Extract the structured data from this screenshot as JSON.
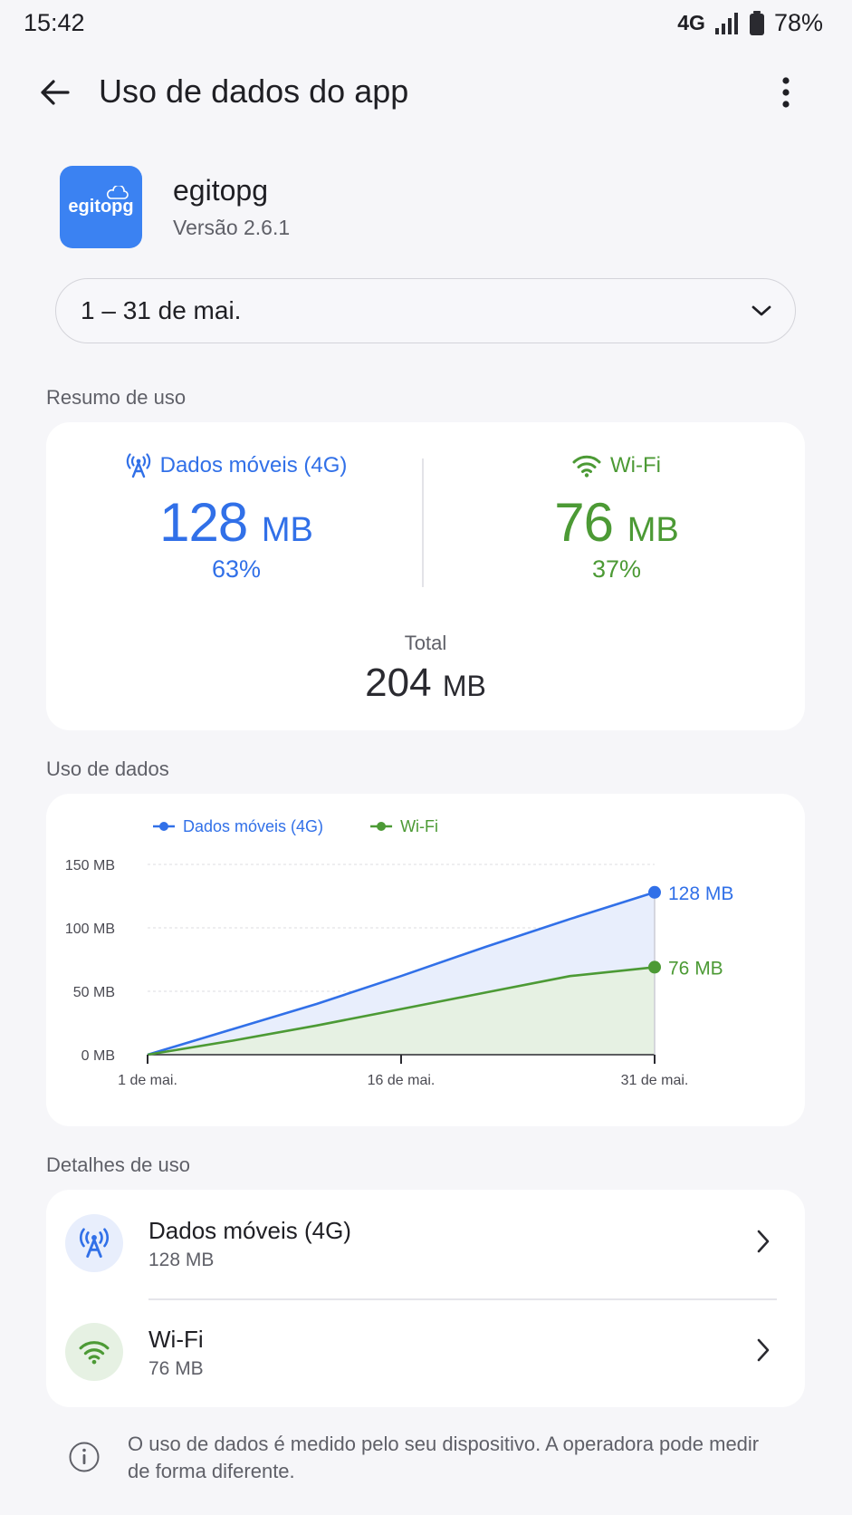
{
  "status_bar": {
    "time": "15:42",
    "network": "4G",
    "battery": "78%"
  },
  "app_bar": {
    "title": "Uso de dados do app",
    "back_icon": "arrow-left-icon",
    "more_icon": "more-vert-icon"
  },
  "app": {
    "icon_text": "egitopg",
    "name": "egitopg",
    "version": "Versão 2.6.1"
  },
  "date_range": {
    "value": "1 – 31 de mai."
  },
  "summary": {
    "label": "Resumo de uso",
    "mobile": {
      "label": "Dados móveis (4G)",
      "value": "128",
      "unit": "MB",
      "percent": "63%",
      "color": "#3170e8"
    },
    "wifi": {
      "label": "Wi-Fi",
      "value": "76",
      "unit": "MB",
      "percent": "37%",
      "color": "#4c9a35"
    },
    "total_label": "Total",
    "total_value": "204",
    "total_unit": "MB"
  },
  "usage_section": {
    "label": "Uso de dados"
  },
  "chart_data": {
    "type": "area",
    "title": "",
    "xlabel": "",
    "ylabel": "",
    "x_ticks": [
      "1 de mai.",
      "16 de mai.",
      "31 de mai."
    ],
    "x_domain": [
      1,
      31
    ],
    "ylim": [
      0,
      150
    ],
    "y_ticks": [
      "0 MB",
      "50 MB",
      "100 MB",
      "150 MB"
    ],
    "grid": true,
    "legend_placement": "top-left",
    "series": [
      {
        "name": "Dados móveis (4G)",
        "color": "#3170e8",
        "fill": "#e8eefc",
        "points": [
          [
            1,
            0
          ],
          [
            6,
            20
          ],
          [
            11,
            40
          ],
          [
            16,
            62
          ],
          [
            21,
            85
          ],
          [
            26,
            107
          ],
          [
            31,
            128
          ]
        ],
        "end_label": "128 MB"
      },
      {
        "name": "Wi-Fi",
        "color": "#4c9a35",
        "fill": "#e6f1e3",
        "points": [
          [
            1,
            0
          ],
          [
            6,
            11
          ],
          [
            11,
            23
          ],
          [
            16,
            36
          ],
          [
            21,
            49
          ],
          [
            26,
            62
          ],
          [
            31,
            69
          ]
        ],
        "end_label": "76 MB"
      }
    ]
  },
  "details": {
    "label": "Detalhes de uso",
    "items": [
      {
        "title": "Dados móveis (4G)",
        "value": "128 MB",
        "icon": "cell-tower-icon"
      },
      {
        "title": "Wi-Fi",
        "value": "76 MB",
        "icon": "wifi-icon"
      }
    ]
  },
  "footer": {
    "note": "O uso de dados é medido pelo seu dispositivo. A operadora pode medir de forma diferente."
  }
}
